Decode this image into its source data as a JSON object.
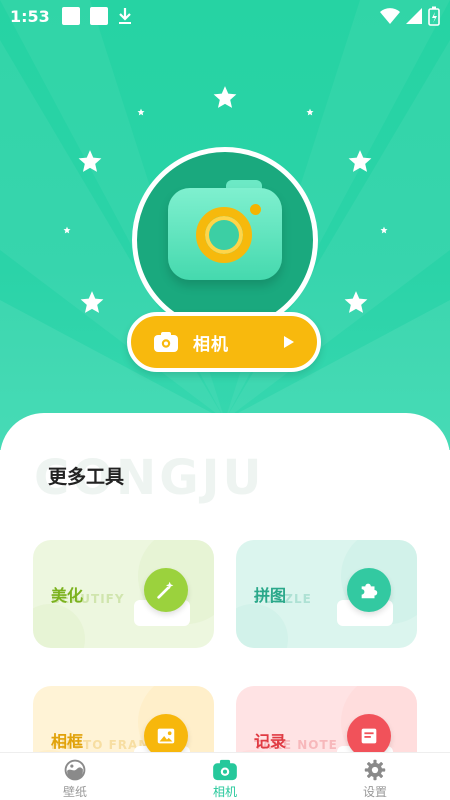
{
  "status_bar": {
    "time": "1:53"
  },
  "hero": {
    "camera_button_label": "相机"
  },
  "tools": {
    "section_title": "更多工具",
    "section_watermark": "CONGJU",
    "items": [
      {
        "label": "美化",
        "sub": "BEAUTIFY",
        "label_color": "#7bb21e",
        "bg": "#edf7df",
        "deco": "#dcefc3",
        "badge": "#9bd23d",
        "icon": "magic-wand-icon"
      },
      {
        "label": "拼图",
        "sub": "PUZZLE",
        "label_color": "#2aa88a",
        "bg": "#dbf5ee",
        "deco": "#c4eee2",
        "badge": "#33c9a1",
        "icon": "puzzle-icon"
      },
      {
        "label": "相框",
        "sub": "PHOTO FRAME",
        "label_color": "#e1a20a",
        "bg": "#fff3d6",
        "deco": "#ffe8b5",
        "badge": "#f7b70c",
        "icon": "photo-frame-icon"
      },
      {
        "label": "记录",
        "sub": "TAKE NOTE",
        "label_color": "#e03b43",
        "bg": "#ffe3e4",
        "deco": "#ffd0d2",
        "badge": "#f1525a",
        "icon": "note-icon"
      }
    ]
  },
  "tabbar": {
    "items": [
      {
        "label": "壁纸",
        "icon": "wallpaper-icon",
        "active": false
      },
      {
        "label": "相机",
        "icon": "camera-icon",
        "active": true
      },
      {
        "label": "设置",
        "icon": "gear-icon",
        "active": false
      }
    ]
  },
  "colors": {
    "accent": "#26d3a3",
    "button": "#f8b90d"
  }
}
